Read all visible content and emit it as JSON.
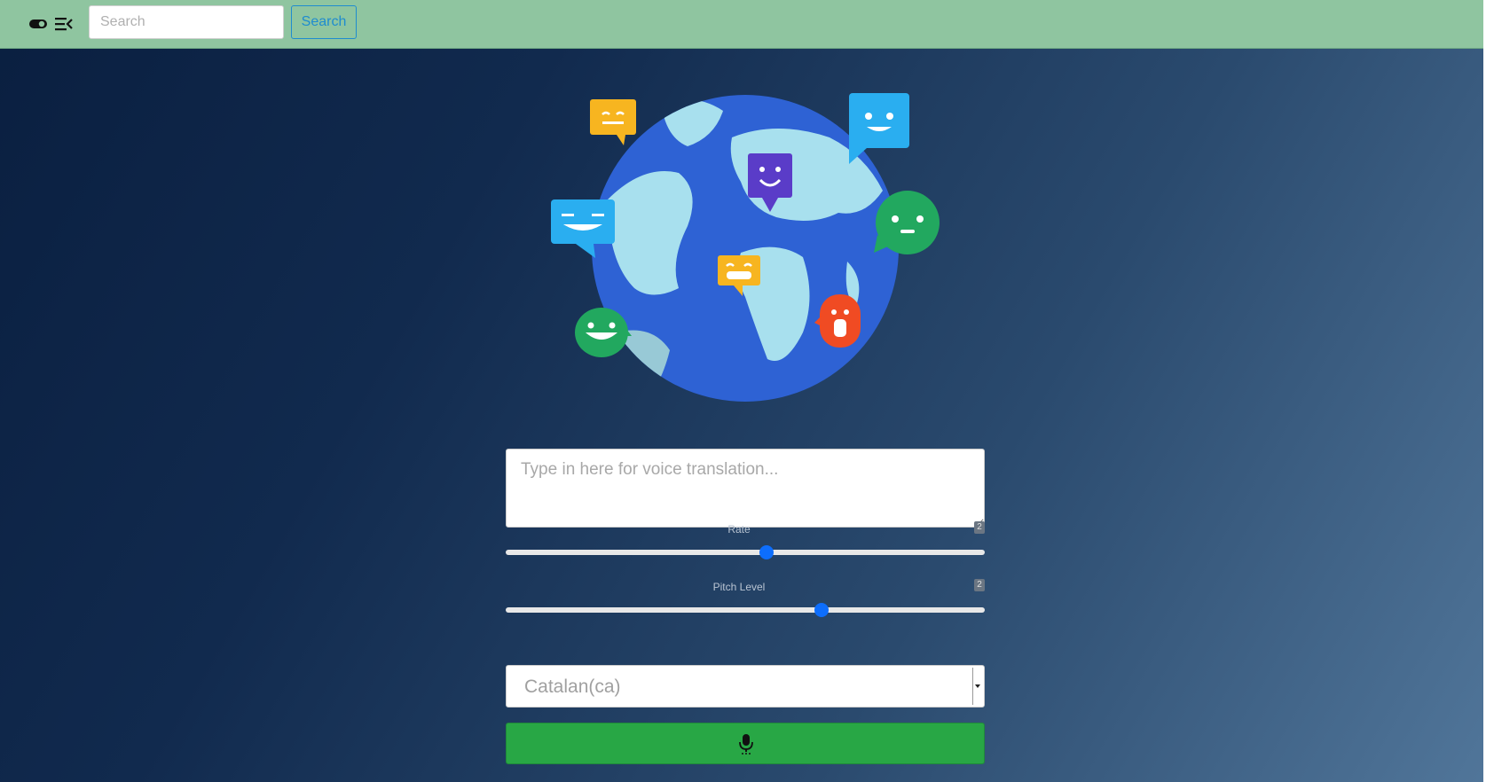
{
  "header": {
    "search_placeholder": "Search",
    "search_button_label": "Search"
  },
  "translator": {
    "textarea_placeholder": "Type in here for voice translation...",
    "rate": {
      "label": "Rate",
      "value": "2",
      "fraction": 0.545
    },
    "pitch": {
      "label": "Pitch Level",
      "value": "2",
      "fraction": 0.66
    },
    "language_select": {
      "selected": "Catalan(ca)"
    },
    "mic_icon": "microphone-icon"
  },
  "colors": {
    "topbar": "#8fc5a0",
    "accent_blue": "#0d6efd",
    "mic_button": "#28a745"
  }
}
